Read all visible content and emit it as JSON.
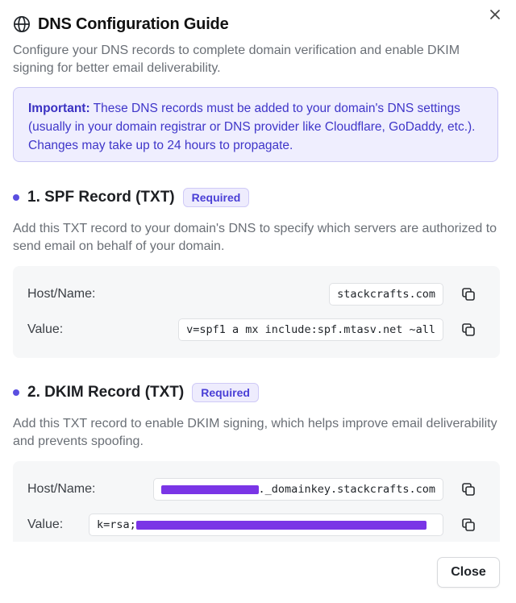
{
  "dialog": {
    "title": "DNS Configuration Guide",
    "subtitle": "Configure your DNS records to complete domain verification and enable DKIM signing for better email deliverability.",
    "close_icon": "close-icon",
    "title_icon": "globe-icon"
  },
  "notice": {
    "bold": "Important:",
    "text": " These DNS records must be added to your domain's DNS settings (usually in your domain registrar or DNS provider like Cloudflare, GoDaddy, etc.). Changes may take up to 24 hours to propagate."
  },
  "spf": {
    "title": "1. SPF Record (TXT)",
    "badge": "Required",
    "description": "Add this TXT record to your domain's DNS to specify which servers are authorized to send email on behalf of your domain.",
    "host_label": "Host/Name:",
    "host_value": "stackcrafts.com",
    "value_label": "Value:",
    "value_value": "v=spf1 a mx include:spf.mtasv.net ~all"
  },
  "dkim": {
    "title": "2. DKIM Record (TXT)",
    "badge": "Required",
    "description": "Add this TXT record to enable DKIM signing, which helps improve email deliverability and prevents spoofing.",
    "host_label": "Host/Name:",
    "host_suffix": "._domainkey.stackcrafts.com",
    "value_label": "Value:",
    "value_prefix": "k=rsa; "
  },
  "footer": {
    "close_label": "Close"
  },
  "colors": {
    "accent": "#5a4fe0",
    "notice_bg": "#efeefe",
    "redaction": "#7a35e6"
  }
}
